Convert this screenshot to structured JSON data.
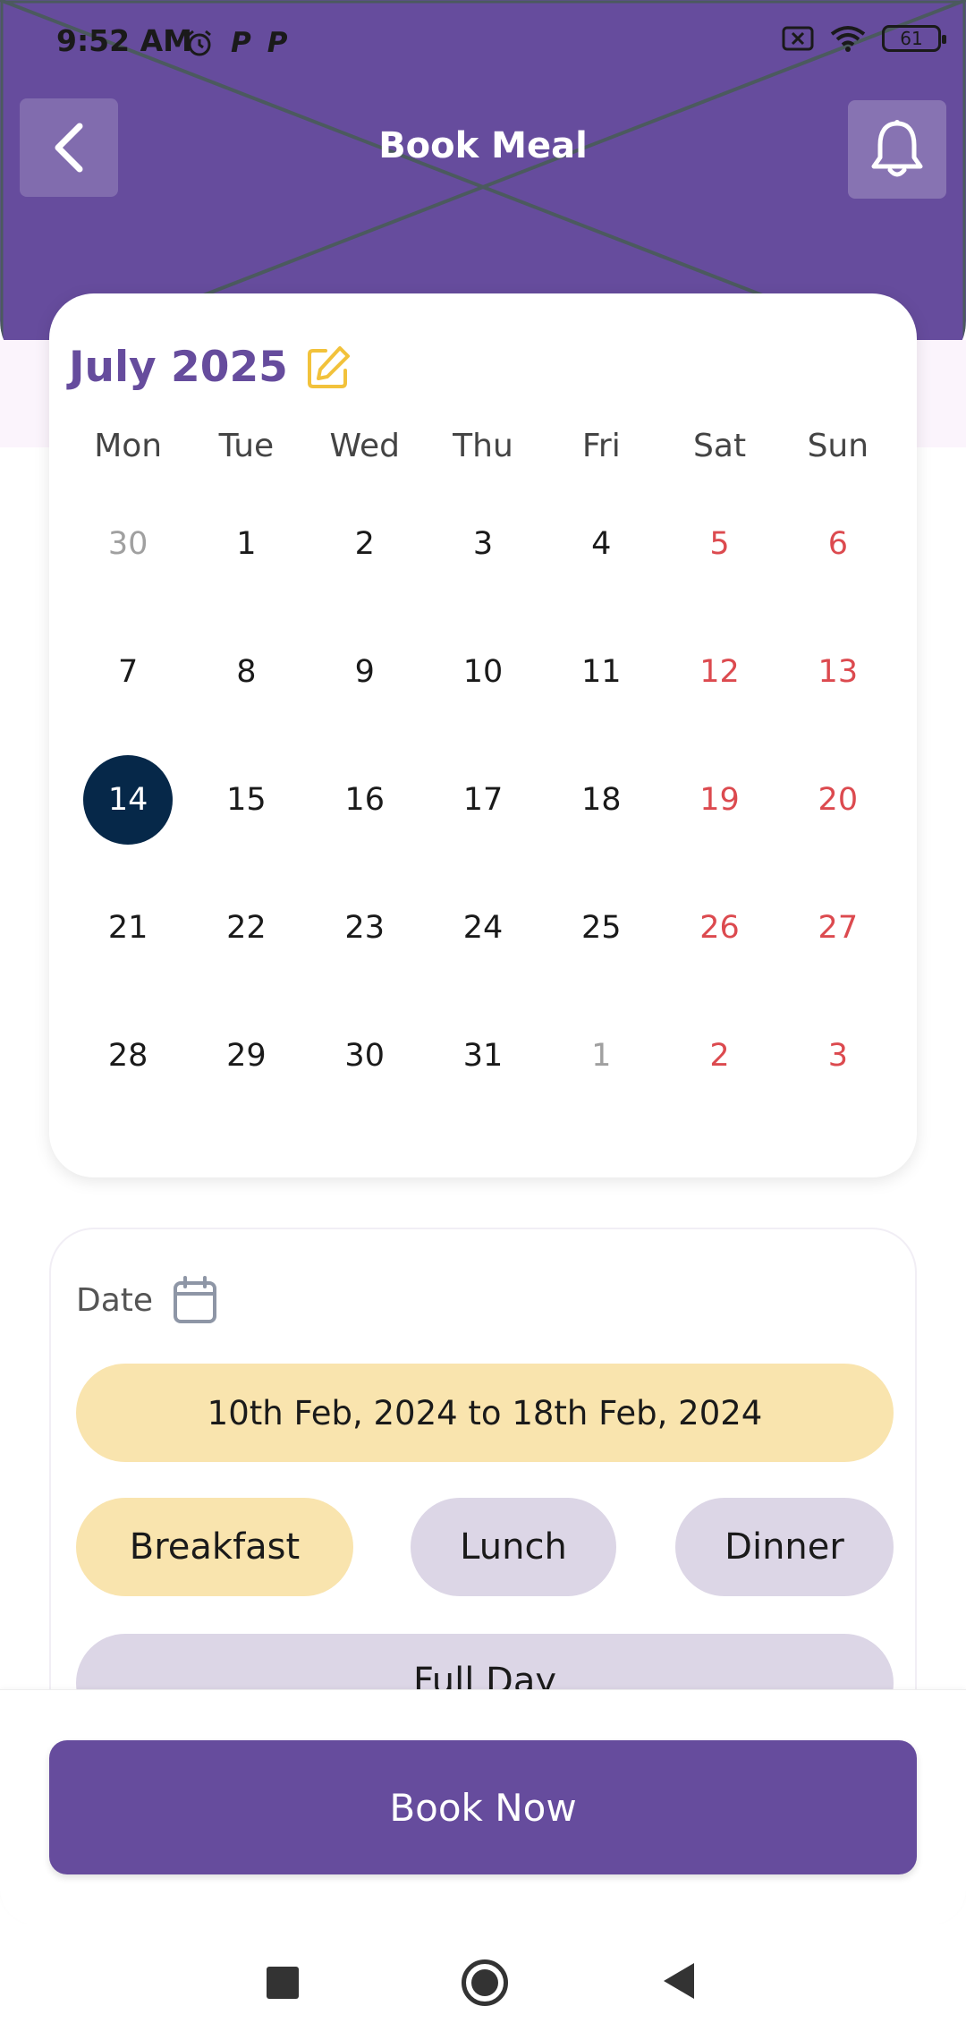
{
  "status_bar": {
    "time": "9:52 AM",
    "left_badges": [
      "P",
      "P"
    ],
    "battery": "61"
  },
  "header": {
    "title": "Book Meal",
    "color": "#664c9d"
  },
  "calendar": {
    "month_label": "July 2025",
    "weekdays": [
      "Mon",
      "Tue",
      "Wed",
      "Thu",
      "Fri",
      "Sat",
      "Sun"
    ],
    "weeks": [
      [
        "30",
        "1",
        "2",
        "3",
        "4",
        "5",
        "6"
      ],
      [
        "7",
        "8",
        "9",
        "10",
        "11",
        "12",
        "13"
      ],
      [
        "14",
        "15",
        "16",
        "17",
        "18",
        "19",
        "20"
      ],
      [
        "21",
        "22",
        "23",
        "24",
        "25",
        "26",
        "27"
      ],
      [
        "28",
        "29",
        "30",
        "31",
        "1",
        "2",
        "3"
      ]
    ],
    "selected_day": "14"
  },
  "booking": {
    "date_label": "Date",
    "date_range": "10th Feb, 2024 to 18th Feb, 2024",
    "meals": {
      "breakfast": "Breakfast",
      "lunch": "Lunch",
      "dinner": "Dinner",
      "full_day": "Full Day"
    },
    "selected_meal": "Breakfast"
  },
  "actions": {
    "book_now": "Book Now"
  }
}
